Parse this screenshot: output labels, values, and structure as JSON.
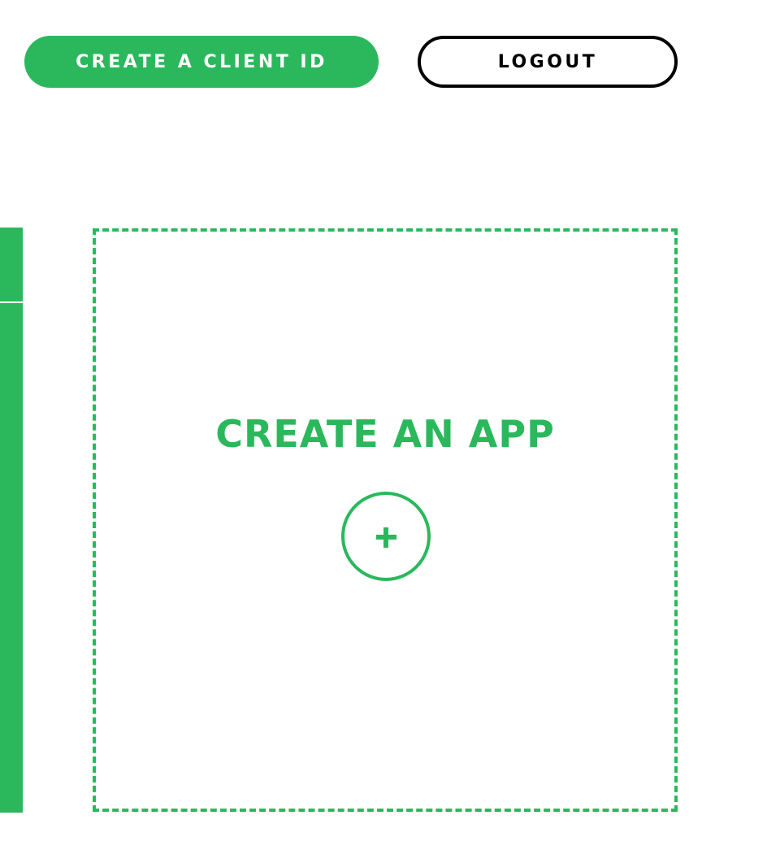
{
  "header": {
    "create_client_id_label": "CREATE A CLIENT ID",
    "logout_label": "LOGOUT"
  },
  "main": {
    "create_app_card": {
      "title": "CREATE AN APP",
      "icon": "plus-circle-icon"
    }
  },
  "colors": {
    "accent": "#2bb85c",
    "outline": "#000000",
    "background": "#ffffff"
  }
}
